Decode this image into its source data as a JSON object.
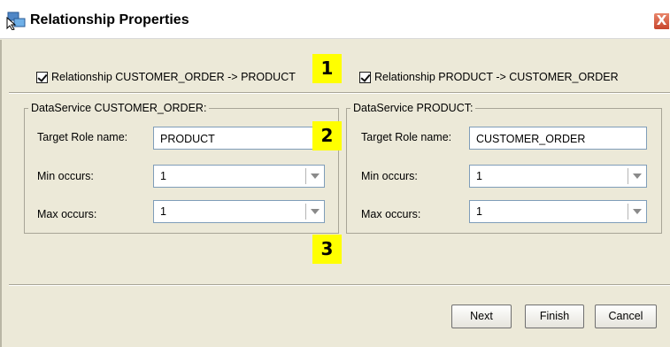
{
  "window": {
    "title": "Relationship Properties",
    "close_glyph": "X"
  },
  "checkboxes": [
    {
      "label": "Relationship CUSTOMER_ORDER -> PRODUCT",
      "checked": true
    },
    {
      "label": "Relationship PRODUCT -> CUSTOMER_ORDER",
      "checked": true
    }
  ],
  "groups": [
    {
      "title": "DataService CUSTOMER_ORDER:",
      "target_role_label": "Target Role name:",
      "target_role_value": "PRODUCT",
      "min_label": "Min occurs:",
      "min_value": "1",
      "max_label": "Max occurs:",
      "max_value": "1"
    },
    {
      "title": "DataService PRODUCT:",
      "target_role_label": "Target Role name:",
      "target_role_value": "CUSTOMER_ORDER",
      "min_label": "Min occurs:",
      "min_value": "1",
      "max_label": "Max occurs:",
      "max_value": "1"
    }
  ],
  "annotations": [
    "1",
    "2",
    "3"
  ],
  "buttons": {
    "next": "Next",
    "finish": "Finish",
    "cancel": "Cancel"
  },
  "colors": {
    "annotation_bg": "#ffff00",
    "dialog_bg": "#ece9d8",
    "close_button": "#d6553a"
  }
}
